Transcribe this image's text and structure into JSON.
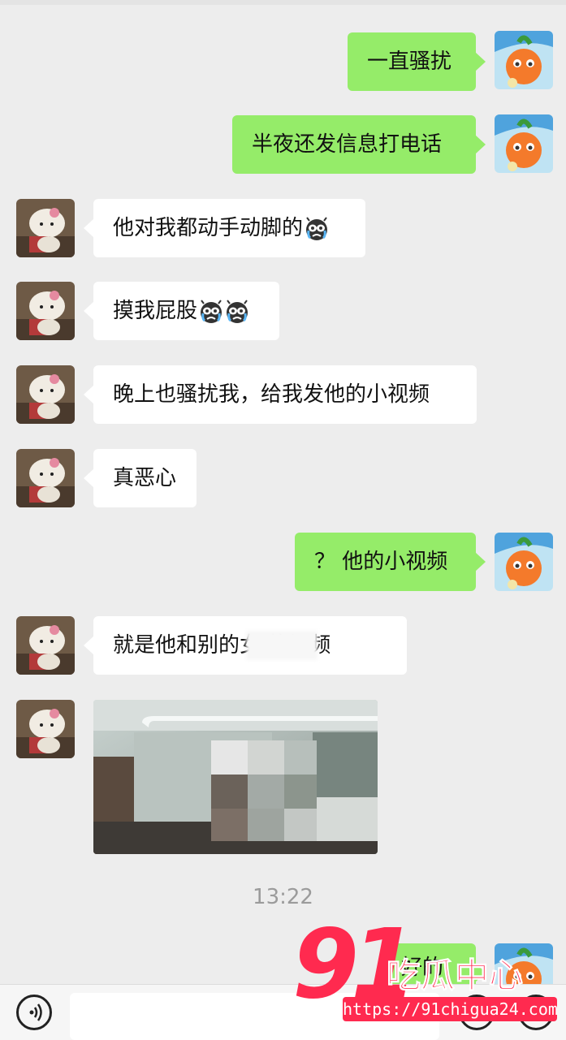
{
  "messages": [
    {
      "from": "me",
      "text": "一直骚扰"
    },
    {
      "from": "me",
      "text": "半夜还发信息打电话"
    },
    {
      "from": "other",
      "text": "他对我都动手动脚的"
    },
    {
      "from": "other",
      "text": "摸我屁股"
    },
    {
      "from": "other",
      "text": "晚上也骚扰我，给我发他的小视频"
    },
    {
      "from": "other",
      "text": "真恶心"
    },
    {
      "from": "me",
      "text": "？ 他的小视频"
    },
    {
      "from": "other",
      "text": "就是他和别的女        的视频"
    },
    {
      "from": "other",
      "type": "video",
      "text": ""
    }
  ],
  "timestamp": "13:22",
  "partial_message": {
    "from": "me",
    "text": "好的"
  },
  "watermark": {
    "number": "91",
    "brand": "吃瓜中心",
    "url": "https://91chigua24.com"
  },
  "icons": {
    "crying_emoji": "crying-face-emoji",
    "voice": "voice-icon",
    "emoji_button": "emoji-icon",
    "plus": "plus-icon"
  },
  "colors": {
    "my_bubble": "#95ec69",
    "their_bubble": "#ffffff",
    "background": "#ededed",
    "watermark": "#ff2a4f"
  }
}
